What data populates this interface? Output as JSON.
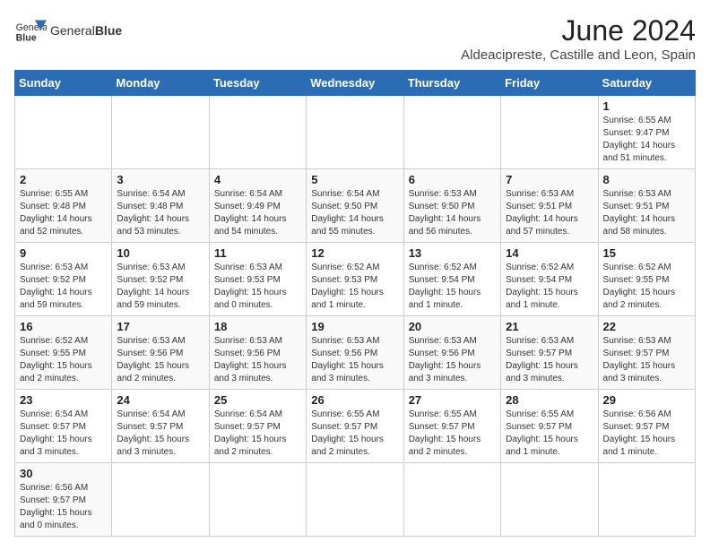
{
  "header": {
    "logo_text_normal": "General",
    "logo_text_bold": "Blue",
    "title": "June 2024",
    "subtitle": "Aldeacipreste, Castille and Leon, Spain"
  },
  "calendar": {
    "days_of_week": [
      "Sunday",
      "Monday",
      "Tuesday",
      "Wednesday",
      "Thursday",
      "Friday",
      "Saturday"
    ],
    "weeks": [
      [
        {
          "day": "",
          "info": ""
        },
        {
          "day": "",
          "info": ""
        },
        {
          "day": "",
          "info": ""
        },
        {
          "day": "",
          "info": ""
        },
        {
          "day": "",
          "info": ""
        },
        {
          "day": "",
          "info": ""
        },
        {
          "day": "1",
          "info": "Sunrise: 6:55 AM\nSunset: 9:47 PM\nDaylight: 14 hours\nand 51 minutes."
        }
      ],
      [
        {
          "day": "2",
          "info": "Sunrise: 6:55 AM\nSunset: 9:48 PM\nDaylight: 14 hours\nand 52 minutes."
        },
        {
          "day": "3",
          "info": "Sunrise: 6:54 AM\nSunset: 9:48 PM\nDaylight: 14 hours\nand 53 minutes."
        },
        {
          "day": "4",
          "info": "Sunrise: 6:54 AM\nSunset: 9:49 PM\nDaylight: 14 hours\nand 54 minutes."
        },
        {
          "day": "5",
          "info": "Sunrise: 6:54 AM\nSunset: 9:50 PM\nDaylight: 14 hours\nand 55 minutes."
        },
        {
          "day": "6",
          "info": "Sunrise: 6:53 AM\nSunset: 9:50 PM\nDaylight: 14 hours\nand 56 minutes."
        },
        {
          "day": "7",
          "info": "Sunrise: 6:53 AM\nSunset: 9:51 PM\nDaylight: 14 hours\nand 57 minutes."
        },
        {
          "day": "8",
          "info": "Sunrise: 6:53 AM\nSunset: 9:51 PM\nDaylight: 14 hours\nand 58 minutes."
        }
      ],
      [
        {
          "day": "9",
          "info": "Sunrise: 6:53 AM\nSunset: 9:52 PM\nDaylight: 14 hours\nand 59 minutes."
        },
        {
          "day": "10",
          "info": "Sunrise: 6:53 AM\nSunset: 9:52 PM\nDaylight: 14 hours\nand 59 minutes."
        },
        {
          "day": "11",
          "info": "Sunrise: 6:53 AM\nSunset: 9:53 PM\nDaylight: 15 hours\nand 0 minutes."
        },
        {
          "day": "12",
          "info": "Sunrise: 6:52 AM\nSunset: 9:53 PM\nDaylight: 15 hours\nand 1 minute."
        },
        {
          "day": "13",
          "info": "Sunrise: 6:52 AM\nSunset: 9:54 PM\nDaylight: 15 hours\nand 1 minute."
        },
        {
          "day": "14",
          "info": "Sunrise: 6:52 AM\nSunset: 9:54 PM\nDaylight: 15 hours\nand 1 minute."
        },
        {
          "day": "15",
          "info": "Sunrise: 6:52 AM\nSunset: 9:55 PM\nDaylight: 15 hours\nand 2 minutes."
        }
      ],
      [
        {
          "day": "16",
          "info": "Sunrise: 6:52 AM\nSunset: 9:55 PM\nDaylight: 15 hours\nand 2 minutes."
        },
        {
          "day": "17",
          "info": "Sunrise: 6:53 AM\nSunset: 9:56 PM\nDaylight: 15 hours\nand 2 minutes."
        },
        {
          "day": "18",
          "info": "Sunrise: 6:53 AM\nSunset: 9:56 PM\nDaylight: 15 hours\nand 3 minutes."
        },
        {
          "day": "19",
          "info": "Sunrise: 6:53 AM\nSunset: 9:56 PM\nDaylight: 15 hours\nand 3 minutes."
        },
        {
          "day": "20",
          "info": "Sunrise: 6:53 AM\nSunset: 9:56 PM\nDaylight: 15 hours\nand 3 minutes."
        },
        {
          "day": "21",
          "info": "Sunrise: 6:53 AM\nSunset: 9:57 PM\nDaylight: 15 hours\nand 3 minutes."
        },
        {
          "day": "22",
          "info": "Sunrise: 6:53 AM\nSunset: 9:57 PM\nDaylight: 15 hours\nand 3 minutes."
        }
      ],
      [
        {
          "day": "23",
          "info": "Sunrise: 6:54 AM\nSunset: 9:57 PM\nDaylight: 15 hours\nand 3 minutes."
        },
        {
          "day": "24",
          "info": "Sunrise: 6:54 AM\nSunset: 9:57 PM\nDaylight: 15 hours\nand 3 minutes."
        },
        {
          "day": "25",
          "info": "Sunrise: 6:54 AM\nSunset: 9:57 PM\nDaylight: 15 hours\nand 2 minutes."
        },
        {
          "day": "26",
          "info": "Sunrise: 6:55 AM\nSunset: 9:57 PM\nDaylight: 15 hours\nand 2 minutes."
        },
        {
          "day": "27",
          "info": "Sunrise: 6:55 AM\nSunset: 9:57 PM\nDaylight: 15 hours\nand 2 minutes."
        },
        {
          "day": "28",
          "info": "Sunrise: 6:55 AM\nSunset: 9:57 PM\nDaylight: 15 hours\nand 1 minute."
        },
        {
          "day": "29",
          "info": "Sunrise: 6:56 AM\nSunset: 9:57 PM\nDaylight: 15 hours\nand 1 minute."
        }
      ],
      [
        {
          "day": "30",
          "info": "Sunrise: 6:56 AM\nSunset: 9:57 PM\nDaylight: 15 hours\nand 0 minutes."
        },
        {
          "day": "",
          "info": ""
        },
        {
          "day": "",
          "info": ""
        },
        {
          "day": "",
          "info": ""
        },
        {
          "day": "",
          "info": ""
        },
        {
          "day": "",
          "info": ""
        },
        {
          "day": "",
          "info": ""
        }
      ]
    ]
  }
}
